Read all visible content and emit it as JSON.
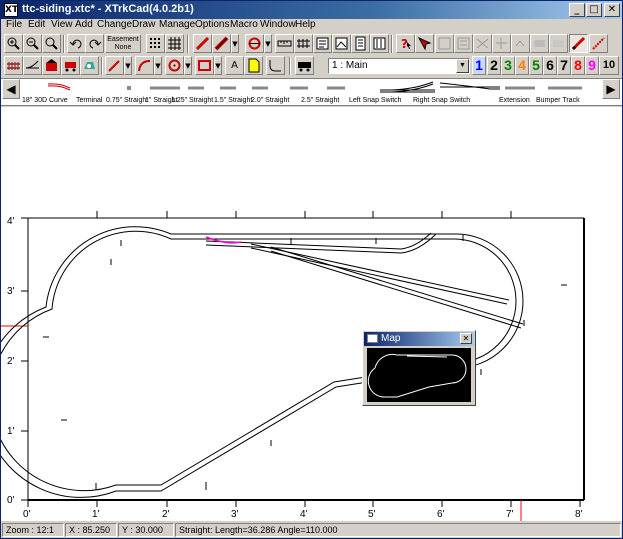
{
  "window": {
    "title": "ttc-siding.xtc* - XTrkCad(4.0.2b1)",
    "app_icon": "XT"
  },
  "caption_buttons": {
    "minimize": "_",
    "maximize": "□",
    "close": "✕"
  },
  "menus": [
    "File",
    "Edit",
    "View",
    "Add",
    "Change",
    "Draw",
    "Manage",
    "Options",
    "Macro",
    "Window",
    "Help"
  ],
  "toolbar": {
    "easement_line1": "Easement",
    "easement_line2": "None",
    "layer_value": "1 : Main",
    "layers": [
      "1",
      "2",
      "3",
      "4",
      "5",
      "6",
      "7",
      "8",
      "9",
      "10"
    ],
    "layer_colors": [
      "#0000ff",
      "#000000",
      "#008000",
      "#ff8000",
      "#008000",
      "#000000",
      "#000000",
      "#ff0000",
      "#ff00ff",
      "#000000"
    ],
    "text_tool": "A"
  },
  "hotbar": {
    "left_arrow": "◀",
    "right_arrow": "▶",
    "items": [
      "18\" 30D Curve",
      "Terminal",
      "0.75\" Straight",
      "1\" Straight",
      "1.25\" Straight",
      "1.5\" Straight",
      "2.0\" Straight",
      "2.5\" Straight",
      "Left Snap Switch",
      "Right Snap Switch",
      "Extension",
      "Bumper Track"
    ]
  },
  "axes": {
    "x_ticks": [
      "0'",
      "1'",
      "2'",
      "3'",
      "4'",
      "5'",
      "6'",
      "7'",
      "8'"
    ],
    "y_ticks": [
      "0'",
      "1'",
      "2'",
      "3'",
      "4'"
    ]
  },
  "map": {
    "title": "Map",
    "close": "✕"
  },
  "status": {
    "zoom": "Zoom : 12:1",
    "x": "X : 85.250",
    "y": "Y : 30.000",
    "message": "Straight: Length=36.286 Angle=110.000"
  },
  "colors": {
    "title_start": "#0a246a",
    "track_highlight": "#ff00cc",
    "pointer_marker": "#ff0000"
  }
}
